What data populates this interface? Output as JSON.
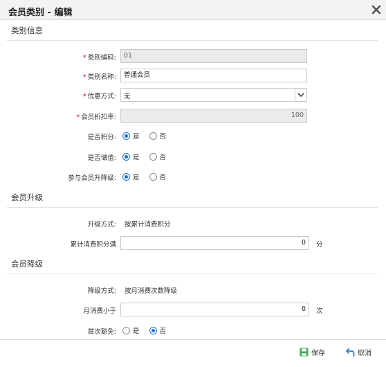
{
  "window": {
    "title": "会员类别 - 编辑"
  },
  "sections": {
    "category": "类别信息",
    "upgrade": "会员升级",
    "downgrade": "会员降级"
  },
  "form": {
    "code": {
      "label": "类别编码:",
      "value": "01",
      "required": true
    },
    "name": {
      "label": "类别名称:",
      "value": "普通会员",
      "required": true
    },
    "discount_method": {
      "label": "优惠方式:",
      "value": "无",
      "required": true
    },
    "discount_rate": {
      "label": "会员折扣率:",
      "value": "100",
      "required": true
    },
    "points": {
      "label": "是否积分:",
      "options": [
        "是",
        "否"
      ],
      "selected": "是"
    },
    "stored_value": {
      "label": "是否储值:",
      "options": [
        "是",
        "否"
      ],
      "selected": "是"
    },
    "level_change": {
      "label": "参与会员升降级:",
      "options": [
        "是",
        "否"
      ],
      "selected": "是"
    }
  },
  "upgrade": {
    "method_label": "升级方式:",
    "method_value": "按累计消费积分",
    "threshold_label": "累计消费积分满",
    "threshold_value": "0",
    "threshold_unit": "分"
  },
  "downgrade": {
    "method_label": "降级方式:",
    "method_value": "按月消费次数降级",
    "threshold_label": "月消费小于",
    "threshold_value": "0",
    "threshold_unit": "次",
    "exempt_label": "首次豁免:",
    "exempt_options": [
      "是",
      "否"
    ],
    "exempt_selected": "否"
  },
  "footer": {
    "save_label": "保存",
    "cancel_label": "取消"
  },
  "colors": {
    "accent": "#1e6fd9",
    "required": "#d9001b",
    "save_icon": "#3aa655",
    "cancel_icon": "#3a78c7"
  },
  "icons": {
    "close": "close-icon",
    "save": "save-icon",
    "cancel": "undo-icon",
    "dropdown": "chevron-down-icon"
  }
}
